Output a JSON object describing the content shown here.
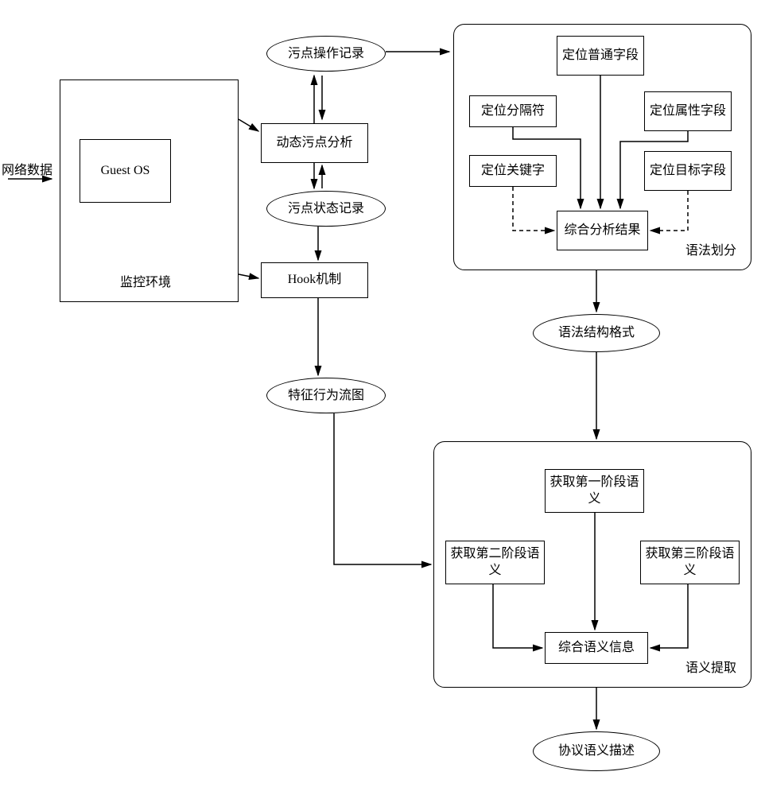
{
  "labels": {
    "network_data": "网络数据",
    "monitor_env": "监控环境",
    "syntax_division": "语法划分",
    "semantic_extract": "语义提取"
  },
  "nodes": {
    "guest_os": "Guest OS",
    "dynamic_taint": "动态污点分析",
    "hook_mech": "Hook机制",
    "taint_op_record": "污点操作记录",
    "taint_state_record": "污点状态记录",
    "feature_flow": "特征行为流图",
    "locate_normal": "定位普通字段",
    "locate_separator": "定位分隔符",
    "locate_attribute": "定位属性字段",
    "locate_keyword": "定位关键字",
    "locate_target": "定位目标字段",
    "combined_analysis": "综合分析结果",
    "syntax_structure": "语法结构格式",
    "stage1_sem": "获取第一阶段语义",
    "stage2_sem": "获取第二阶段语义",
    "stage3_sem": "获取第三阶段语义",
    "combined_sem": "综合语义信息",
    "protocol_desc": "协议语义描述"
  }
}
